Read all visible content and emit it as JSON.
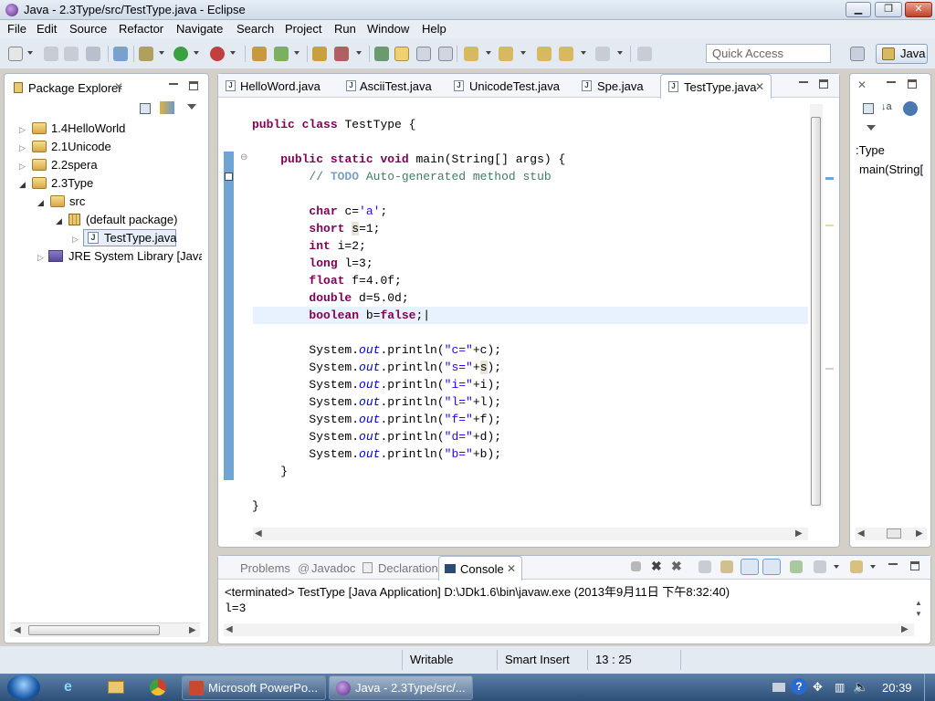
{
  "window": {
    "title": "Java - 2.3Type/src/TestType.java - Eclipse"
  },
  "menu": [
    "File",
    "Edit",
    "Source",
    "Refactor",
    "Navigate",
    "Search",
    "Project",
    "Run",
    "Window",
    "Help"
  ],
  "toolbar": {
    "quick_access_placeholder": "Quick Access",
    "perspective": "Java"
  },
  "package_explorer": {
    "title": "Package Explorer",
    "items": [
      "1.4HelloWorld",
      "2.1Unicode",
      "2.2spera",
      "2.3Type",
      "src",
      "(default package)",
      "TestType.java",
      "JRE System Library [JavaS"
    ]
  },
  "editor": {
    "tabs": [
      "HelloWord.java",
      "AsciiTest.java",
      "UnicodeTest.java",
      "Spe.java",
      "TestType.java"
    ],
    "active_tab": "TestType.java"
  },
  "outline": {
    "items": [
      ":Type",
      "main(String["
    ]
  },
  "console": {
    "tabs": [
      "Problems",
      "Javadoc",
      "Declaration",
      "Console"
    ],
    "status": "<terminated> TestType [Java Application] D:\\JDk1.6\\bin\\javaw.exe (2013年9月11日 下午8:32:40)",
    "output": "l=3"
  },
  "statusbar": {
    "mode": "Writable",
    "insert": "Smart Insert",
    "position": "13 : 25"
  },
  "taskbar": {
    "buttons": [
      "Microsoft PowerPo...",
      "Java - 2.3Type/src/..."
    ],
    "clock": "20:39"
  },
  "colors": {
    "keyword": "#7f0055",
    "string": "#2a00ff",
    "comment": "#3f7f5f",
    "field": "#0000c0"
  }
}
